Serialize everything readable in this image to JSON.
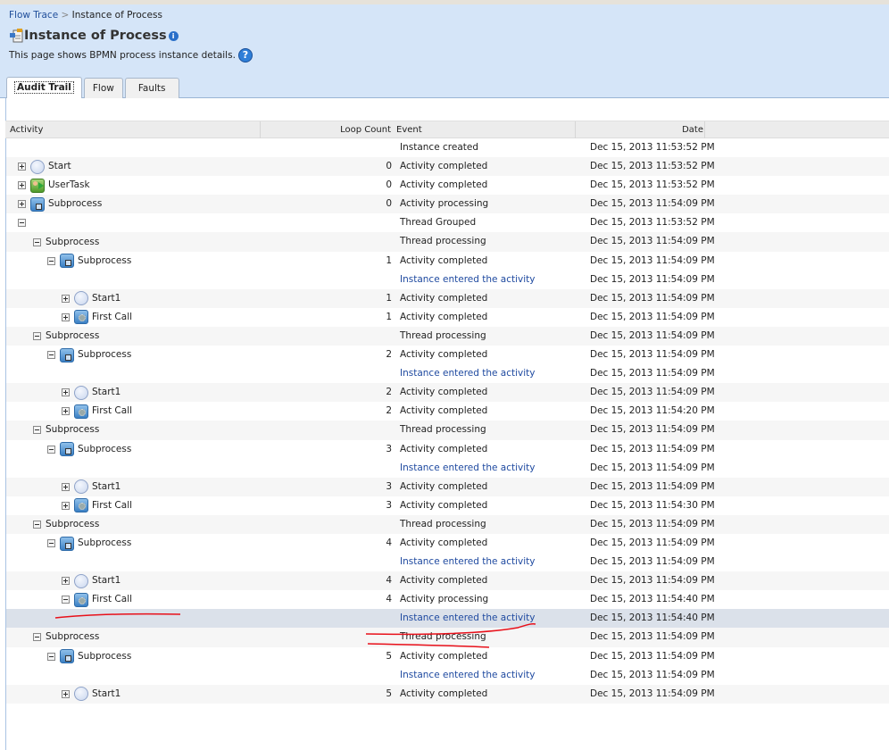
{
  "breadcrumb": {
    "parent": "Flow Trace",
    "separator": ">",
    "current": "Instance of Process"
  },
  "page": {
    "title": "Instance of Process",
    "description": "This page shows BPMN process instance details.",
    "help_icon": "?",
    "info_icon": "i"
  },
  "tabs": [
    {
      "label": "Audit Trail",
      "active": true
    },
    {
      "label": "Flow"
    },
    {
      "label": "Faults"
    }
  ],
  "table": {
    "columns": {
      "activity": "Activity",
      "loop": "Loop Count",
      "event": "Event",
      "date": "Date"
    },
    "rows": [
      {
        "depth": -1,
        "toggle": "",
        "icon": "",
        "label": "",
        "loop": "",
        "event": "Instance created",
        "date": "Dec 15, 2013 11:53:52 PM"
      },
      {
        "depth": 0,
        "toggle": "plus",
        "icon": "circle",
        "label": "Start",
        "loop": "0",
        "event": "Activity completed",
        "date": "Dec 15, 2013 11:53:52 PM"
      },
      {
        "depth": 0,
        "toggle": "plus",
        "icon": "user",
        "label": "UserTask",
        "loop": "0",
        "event": "Activity completed",
        "date": "Dec 15, 2013 11:53:52 PM"
      },
      {
        "depth": 0,
        "toggle": "plus",
        "icon": "sub",
        "label": "Subprocess",
        "loop": "0",
        "event": "Activity processing",
        "date": "Dec 15, 2013 11:54:09 PM"
      },
      {
        "depth": 0,
        "toggle": "minus",
        "icon": "",
        "label": "",
        "loop": "",
        "event": "Thread Grouped",
        "date": "Dec 15, 2013 11:53:52 PM"
      },
      {
        "depth": 1,
        "toggle": "minus",
        "icon": "",
        "label": "Subprocess",
        "loop": "",
        "event": "Thread processing",
        "date": "Dec 15, 2013 11:54:09 PM"
      },
      {
        "depth": 2,
        "toggle": "minus",
        "icon": "sub",
        "label": "Subprocess",
        "loop": "1",
        "event": "Activity completed",
        "date": "Dec 15, 2013 11:54:09 PM"
      },
      {
        "depth": -1,
        "link": true,
        "toggle": "",
        "icon": "",
        "label": "",
        "loop": "",
        "event": "Instance entered the activity",
        "date": "Dec 15, 2013 11:54:09 PM"
      },
      {
        "depth": 3,
        "toggle": "plus",
        "icon": "circle",
        "label": "Start1",
        "loop": "1",
        "event": "Activity completed",
        "date": "Dec 15, 2013 11:54:09 PM"
      },
      {
        "depth": 3,
        "toggle": "plus",
        "icon": "gear",
        "label": "First Call",
        "loop": "1",
        "event": "Activity completed",
        "date": "Dec 15, 2013 11:54:09 PM"
      },
      {
        "depth": 1,
        "toggle": "minus",
        "icon": "",
        "label": "Subprocess",
        "loop": "",
        "event": "Thread processing",
        "date": "Dec 15, 2013 11:54:09 PM"
      },
      {
        "depth": 2,
        "toggle": "minus",
        "icon": "sub",
        "label": "Subprocess",
        "loop": "2",
        "event": "Activity completed",
        "date": "Dec 15, 2013 11:54:09 PM"
      },
      {
        "depth": -1,
        "link": true,
        "toggle": "",
        "icon": "",
        "label": "",
        "loop": "",
        "event": "Instance entered the activity",
        "date": "Dec 15, 2013 11:54:09 PM"
      },
      {
        "depth": 3,
        "toggle": "plus",
        "icon": "circle",
        "label": "Start1",
        "loop": "2",
        "event": "Activity completed",
        "date": "Dec 15, 2013 11:54:09 PM"
      },
      {
        "depth": 3,
        "toggle": "plus",
        "icon": "gear",
        "label": "First Call",
        "loop": "2",
        "event": "Activity completed",
        "date": "Dec 15, 2013 11:54:20 PM"
      },
      {
        "depth": 1,
        "toggle": "minus",
        "icon": "",
        "label": "Subprocess",
        "loop": "",
        "event": "Thread processing",
        "date": "Dec 15, 2013 11:54:09 PM"
      },
      {
        "depth": 2,
        "toggle": "minus",
        "icon": "sub",
        "label": "Subprocess",
        "loop": "3",
        "event": "Activity completed",
        "date": "Dec 15, 2013 11:54:09 PM"
      },
      {
        "depth": -1,
        "link": true,
        "toggle": "",
        "icon": "",
        "label": "",
        "loop": "",
        "event": "Instance entered the activity",
        "date": "Dec 15, 2013 11:54:09 PM"
      },
      {
        "depth": 3,
        "toggle": "plus",
        "icon": "circle",
        "label": "Start1",
        "loop": "3",
        "event": "Activity completed",
        "date": "Dec 15, 2013 11:54:09 PM"
      },
      {
        "depth": 3,
        "toggle": "plus",
        "icon": "gear",
        "label": "First Call",
        "loop": "3",
        "event": "Activity completed",
        "date": "Dec 15, 2013 11:54:30 PM"
      },
      {
        "depth": 1,
        "toggle": "minus",
        "icon": "",
        "label": "Subprocess",
        "loop": "",
        "event": "Thread processing",
        "date": "Dec 15, 2013 11:54:09 PM"
      },
      {
        "depth": 2,
        "toggle": "minus",
        "icon": "sub",
        "label": "Subprocess",
        "loop": "4",
        "event": "Activity completed",
        "date": "Dec 15, 2013 11:54:09 PM"
      },
      {
        "depth": -1,
        "link": true,
        "toggle": "",
        "icon": "",
        "label": "",
        "loop": "",
        "event": "Instance entered the activity",
        "date": "Dec 15, 2013 11:54:09 PM"
      },
      {
        "depth": 3,
        "toggle": "plus",
        "icon": "circle",
        "label": "Start1",
        "loop": "4",
        "event": "Activity completed",
        "date": "Dec 15, 2013 11:54:09 PM"
      },
      {
        "depth": 3,
        "toggle": "minus",
        "icon": "gear",
        "label": "First Call",
        "loop": "4",
        "event": "Activity processing",
        "date": "Dec 15, 2013 11:54:40 PM"
      },
      {
        "depth": -1,
        "link": true,
        "selected": true,
        "toggle": "",
        "icon": "",
        "label": "",
        "loop": "",
        "event": "Instance entered the activity",
        "date": "Dec 15, 2013 11:54:40 PM"
      },
      {
        "depth": 1,
        "toggle": "minus",
        "icon": "",
        "label": "Subprocess",
        "loop": "",
        "event": "Thread processing",
        "date": "Dec 15, 2013 11:54:09 PM"
      },
      {
        "depth": 2,
        "toggle": "minus",
        "icon": "sub",
        "label": "Subprocess",
        "loop": "5",
        "event": "Activity completed",
        "date": "Dec 15, 2013 11:54:09 PM"
      },
      {
        "depth": -1,
        "link": true,
        "toggle": "",
        "icon": "",
        "label": "",
        "loop": "",
        "event": "Instance entered the activity",
        "date": "Dec 15, 2013 11:54:09 PM"
      },
      {
        "depth": 3,
        "toggle": "plus",
        "icon": "circle",
        "label": "Start1",
        "loop": "5",
        "event": "Activity completed",
        "date": "Dec 15, 2013 11:54:09 PM"
      }
    ]
  },
  "colors": {
    "header_bg": "#d5e5f8",
    "link": "#1f4aa0",
    "annotation": "#e8101a",
    "selected": "#dbe1ea"
  }
}
